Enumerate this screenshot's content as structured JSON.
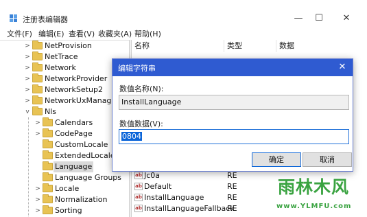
{
  "window": {
    "title": "注册表编辑器",
    "controls": {
      "minimize": "—",
      "maximize": "☐",
      "close": "✕"
    }
  },
  "menu": [
    "文件(F)",
    "编辑(E)",
    "查看(V)",
    "收藏夹(A)",
    "帮助(H)"
  ],
  "tree": {
    "items": [
      {
        "label": "NetProvision",
        "expander": ">"
      },
      {
        "label": "NetTrace",
        "expander": ">"
      },
      {
        "label": "Network",
        "expander": ">"
      },
      {
        "label": "NetworkProvider",
        "expander": ">"
      },
      {
        "label": "NetworkSetup2",
        "expander": ">"
      },
      {
        "label": "NetworkUxManager",
        "expander": ">"
      },
      {
        "label": "Nls",
        "expander": "v"
      },
      {
        "label": "Calendars",
        "expander": ">"
      },
      {
        "label": "CodePage",
        "expander": ">"
      },
      {
        "label": "CustomLocale",
        "expander": ""
      },
      {
        "label": "ExtendedLocale",
        "expander": ""
      },
      {
        "label": "Language",
        "expander": "",
        "selected": true
      },
      {
        "label": "Language Groups",
        "expander": ""
      },
      {
        "label": "Locale",
        "expander": ">"
      },
      {
        "label": "Normalization",
        "expander": ">"
      },
      {
        "label": "Sorting",
        "expander": ">"
      }
    ]
  },
  "list": {
    "columns": [
      "名称",
      "类型",
      "数据"
    ],
    "rows": [
      {
        "name": "Jc0a",
        "type": "RE"
      },
      {
        "name": "Default",
        "type": "RE"
      },
      {
        "name": "InstallLanguage",
        "type": "RE"
      },
      {
        "name": "InstallLanguageFallback",
        "type": "RE"
      }
    ],
    "icon_text": "ab"
  },
  "dialog": {
    "title": "编辑字符串",
    "close": "✕",
    "name_label": "数值名称(N):",
    "name_value": "InstallLanguage",
    "data_label": "数值数据(V):",
    "data_value": "0804",
    "ok_label": "确定",
    "cancel_label": "取消"
  },
  "watermark": {
    "logo": "雨林木风",
    "url": "www.YLMFU.com"
  },
  "colors": {
    "dialog_title": "#2f5bd1",
    "selection": "#0a64d8",
    "folder": "#e8c354",
    "watermark": "#3aa341"
  }
}
